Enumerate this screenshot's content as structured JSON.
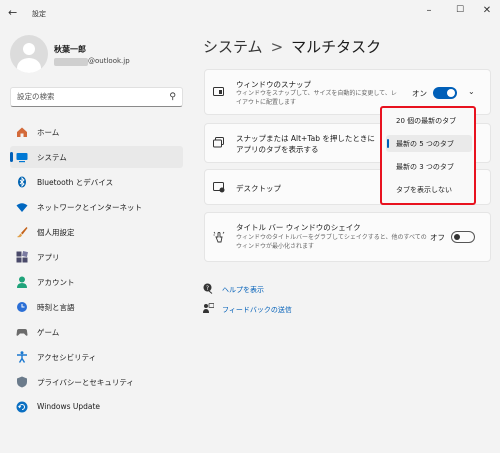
{
  "window": {
    "title": "設定"
  },
  "user": {
    "name": "秋葉一郎",
    "email_domain": "@outlook.jp"
  },
  "search": {
    "placeholder": "設定の検索"
  },
  "sidebar": {
    "items": [
      {
        "label": "ホーム",
        "icon": "home-icon",
        "color": "#d36a3a"
      },
      {
        "label": "システム",
        "icon": "system-icon",
        "color": "#0078d4",
        "active": true
      },
      {
        "label": "Bluetooth とデバイス",
        "icon": "bluetooth-icon",
        "color": "#0063b1"
      },
      {
        "label": "ネットワークとインターネット",
        "icon": "network-icon",
        "color": "#0067c0"
      },
      {
        "label": "個人用設定",
        "icon": "brush-icon",
        "color": "#c4621a"
      },
      {
        "label": "アプリ",
        "icon": "apps-icon",
        "color": "#4a4a6a"
      },
      {
        "label": "アカウント",
        "icon": "account-icon",
        "color": "#1fa37a"
      },
      {
        "label": "時刻と言語",
        "icon": "time-language-icon",
        "color": "#2b6fd6"
      },
      {
        "label": "ゲーム",
        "icon": "gaming-icon",
        "color": "#6b6b6b"
      },
      {
        "label": "アクセシビリティ",
        "icon": "accessibility-icon",
        "color": "#1a78d0"
      },
      {
        "label": "プライバシーとセキュリティ",
        "icon": "shield-icon",
        "color": "#6b7b8b"
      },
      {
        "label": "Windows Update",
        "icon": "update-icon",
        "color": "#0a6fc2"
      }
    ]
  },
  "header": {
    "section": "システム",
    "page": "マルチタスク"
  },
  "settings": {
    "snap": {
      "title": "ウィンドウのスナップ",
      "desc_line1": "ウィンドウをスナップして、サイズを自動的に変更して、レ",
      "desc_line2": "イアウトに配置します",
      "state": "オン"
    },
    "snap_alt_tab": {
      "title_line1": "スナップまたは Alt+Tab を押したときに",
      "title_line2": "アプリのタブを表示する"
    },
    "desktops": {
      "title": "デスクトップ"
    },
    "shake": {
      "title": "タイトル バー ウィンドウのシェイク",
      "desc_line1": "ウィンドウのタイトルバーをグラブしてシェイクすると、他のすべての",
      "desc_line2": "ウィンドウが最小化されます",
      "state": "オフ"
    }
  },
  "dropdown": {
    "options": [
      "20 個の最新のタブ",
      "最新の 5 つのタブ",
      "最新の 3 つのタブ",
      "タブを表示しない"
    ],
    "selected_index": 1,
    "highlight_color": "#e8121f"
  },
  "links": {
    "help": "ヘルプを表示",
    "feedback": "フィードバックの送信"
  },
  "colors": {
    "accent": "#005fb8"
  }
}
